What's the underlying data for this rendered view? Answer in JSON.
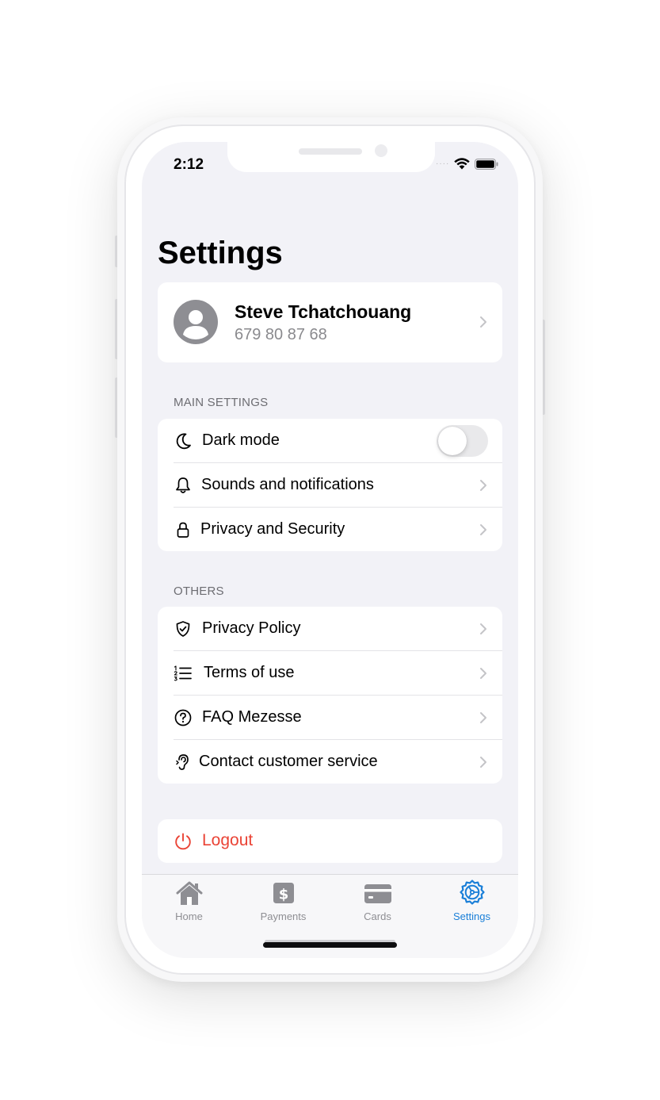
{
  "status_bar": {
    "time": "2:12"
  },
  "page": {
    "title": "Settings"
  },
  "profile": {
    "name": "Steve Tchatchouang",
    "phone": "679 80 87 68"
  },
  "main_settings": {
    "header": "MAIN SETTINGS",
    "items": [
      {
        "label": "Dark mode",
        "icon": "moon-icon",
        "control": "toggle",
        "toggle_on": false
      },
      {
        "label": "Sounds and notifications",
        "icon": "bell-icon",
        "control": "chevron"
      },
      {
        "label": "Privacy and Security",
        "icon": "lock-icon",
        "control": "chevron"
      }
    ]
  },
  "others": {
    "header": "OTHERS",
    "items": [
      {
        "label": "Privacy Policy",
        "icon": "shield-check-icon"
      },
      {
        "label": "Terms of use",
        "icon": "list-icon"
      },
      {
        "label": "FAQ Mezesse",
        "icon": "question-circle-icon"
      },
      {
        "label": "Contact customer service",
        "icon": "ear-icon"
      }
    ]
  },
  "logout": {
    "label": "Logout",
    "icon": "power-icon",
    "color": "#ea4335"
  },
  "tabbar": {
    "tabs": [
      {
        "label": "Home",
        "icon": "house-icon",
        "active": false
      },
      {
        "label": "Payments",
        "icon": "dollar-icon",
        "active": false
      },
      {
        "label": "Cards",
        "icon": "card-icon",
        "active": false
      },
      {
        "label": "Settings",
        "icon": "gear-icon",
        "active": true
      }
    ],
    "active_color": "#1a7fd8",
    "inactive_color": "#8e8e93"
  }
}
